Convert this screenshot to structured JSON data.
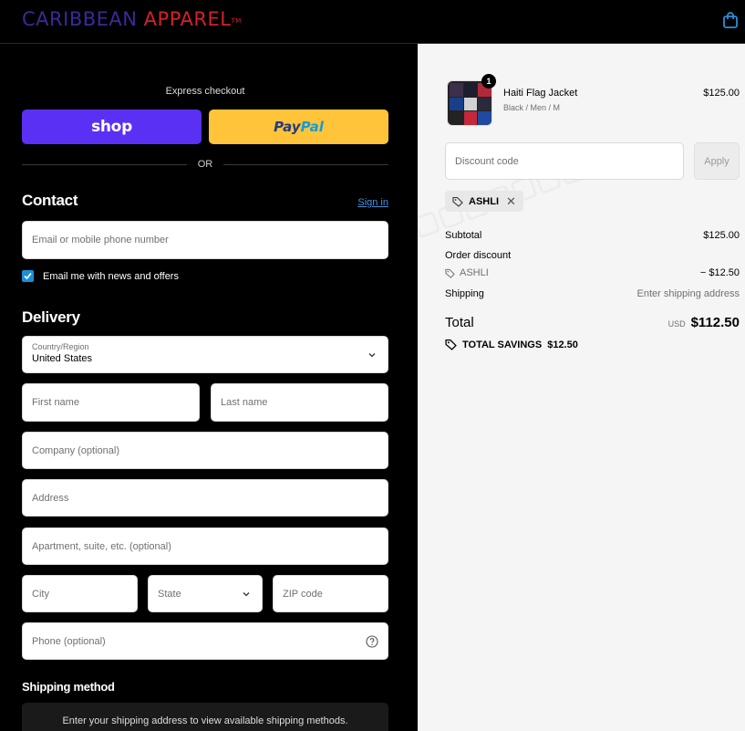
{
  "brand": {
    "part1": "CARIBBEAN",
    "part2": "APPAREL",
    "tm": "TM"
  },
  "express": {
    "label": "Express checkout",
    "shop_label": "shop",
    "paypal_part1": "Pay",
    "paypal_part2": "Pal",
    "or_label": "OR"
  },
  "contact": {
    "heading": "Contact",
    "sign_in": "Sign in",
    "email_placeholder": "Email or mobile phone number",
    "newsletter_label": "Email me with news and offers"
  },
  "delivery": {
    "heading": "Delivery",
    "country_label": "Country/Region",
    "country_value": "United States",
    "first_name": "First name",
    "last_name": "Last name",
    "company": "Company (optional)",
    "address": "Address",
    "apartment": "Apartment, suite, etc. (optional)",
    "city": "City",
    "state": "State",
    "zip": "ZIP code",
    "phone": "Phone (optional)"
  },
  "shipping": {
    "heading": "Shipping method",
    "message": "Enter your shipping address to view available shipping methods."
  },
  "cart": {
    "item": {
      "name": "Haiti Flag Jacket",
      "variant": "Black / Men / M",
      "price": "$125.00",
      "quantity": "1"
    },
    "discount_placeholder": "Discount code",
    "apply_label": "Apply",
    "applied_code": "ASHLI",
    "subtotal_label": "Subtotal",
    "subtotal_value": "$125.00",
    "order_discount_label": "Order discount",
    "discount_code": "ASHLI",
    "discount_value": "− $12.50",
    "shipping_label": "Shipping",
    "shipping_value": "Enter shipping address",
    "total_label": "Total",
    "total_currency": "USD",
    "total_value": "$112.50",
    "savings_label": "TOTAL SAVINGS",
    "savings_value": "$12.50"
  },
  "colors": {
    "shop": "#5a31f4",
    "paypal": "#ffc439",
    "checkbox": "#1e8fd6",
    "link": "#4a8fe0"
  }
}
